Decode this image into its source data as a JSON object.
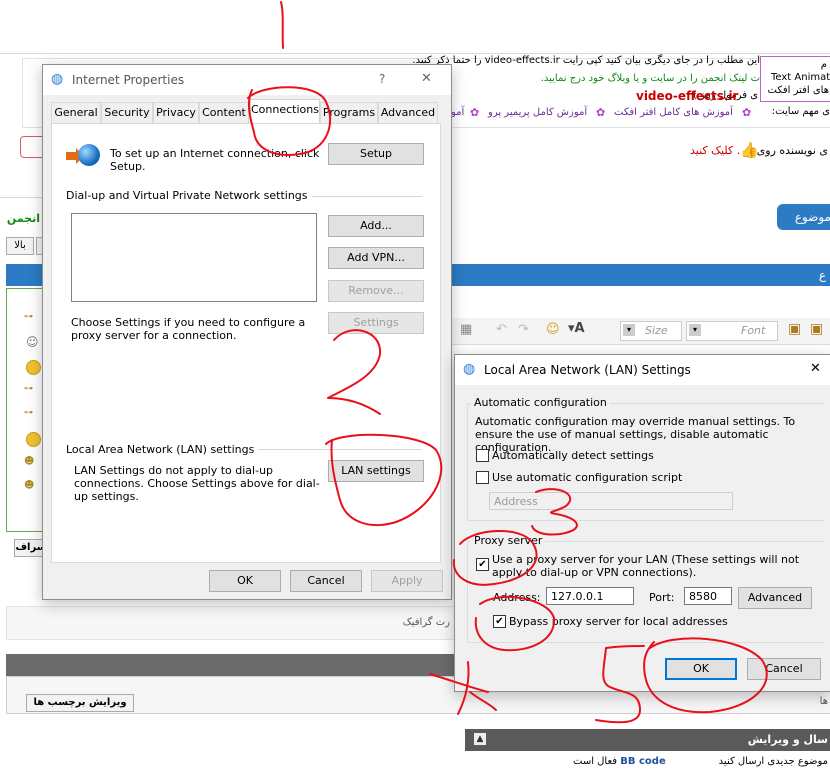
{
  "forum": {
    "line1": "این مطلب را در جای دیگری بیان کنید کپی رایت video-effects.ir را حتما ذکر کنید.",
    "line2": "ت لینک انجمن را در سایت و یا وبلاگ خود درج نمایید.",
    "brand": "video-effects.ir",
    "line3_prefix": "ی فرمول رمز ) :",
    "line4": "ی مهم سایت:",
    "link1": "آموزش های کامل افتر افکت",
    "link2": "آموزش کامل پریمیر پرو",
    "link3": "آمو",
    "author_line": "ی نویسنده روی",
    "click_text": "کلیک کنید .",
    "anjoman": "انجمن",
    "bala": "بالا",
    "new_topic_button": "موضوع",
    "right_header": "ع",
    "font_placeholder": "Font",
    "size_placeholder": "Size",
    "graphic_text": "رت گرافیک",
    "edit_tags_button": "ویرایش برچسب ها",
    "send_edit_header": "سال و ویرایش",
    "bbcode_label": "BB code",
    "bbcode_active": "فعال است",
    "new_topic_send": "موضوع جدیدی ارسال کنید",
    "side_button": "سراف",
    "side_text": "ها",
    "tooltip_line1": "م",
    "tooltip_line2": "Text Animat",
    "tooltip_line3": "های افتر افکت"
  },
  "internet_properties": {
    "title": "Internet Properties",
    "help": "?",
    "close": "✕",
    "tabs": [
      "General",
      "Security",
      "Privacy",
      "Content",
      "Connections",
      "Programs",
      "Advanced"
    ],
    "setup_text": "To set up an Internet connection, click Setup.",
    "setup_button": "Setup",
    "dialup_group": "Dial-up and Virtual Private Network settings",
    "add_button": "Add...",
    "add_vpn_button": "Add VPN...",
    "remove_button": "Remove...",
    "settings_button": "Settings",
    "proxy_text": "Choose Settings if you need to configure a proxy server for a connection.",
    "lan_group": "Local Area Network (LAN) settings",
    "lan_text": "LAN Settings do not apply to dial-up connections. Choose Settings above for dial-up settings.",
    "lan_button": "LAN settings",
    "ok": "OK",
    "cancel": "Cancel",
    "apply": "Apply"
  },
  "lan_settings": {
    "title": "Local Area Network (LAN) Settings",
    "close": "✕",
    "auto_group": "Automatic configuration",
    "auto_text": "Automatic configuration may override manual settings.  To ensure the use of manual settings, disable automatic configuration.",
    "auto_detect_label": "Automatically detect settings",
    "auto_detect_checked": false,
    "auto_script_label": "Use automatic configuration script",
    "auto_script_checked": false,
    "address_placeholder": "Address",
    "proxy_group": "Proxy server",
    "use_proxy_label": "Use a proxy server for your LAN (These settings will not apply to dial-up or VPN connections).",
    "use_proxy_checked": true,
    "address_label": "Address:",
    "address_value": "127.0.0.1",
    "port_label": "Port:",
    "port_value": "8580",
    "advanced_button": "Advanced",
    "bypass_label": "Bypass proxy server for local addresses",
    "bypass_checked": true,
    "ok": "OK",
    "cancel": "Cancel"
  },
  "colors": {
    "annotation": "#e8101a",
    "accent": "#0078d7",
    "brand_red": "#cc0000",
    "link_green": "#118811",
    "forum_blue": "#2d7bc4"
  }
}
